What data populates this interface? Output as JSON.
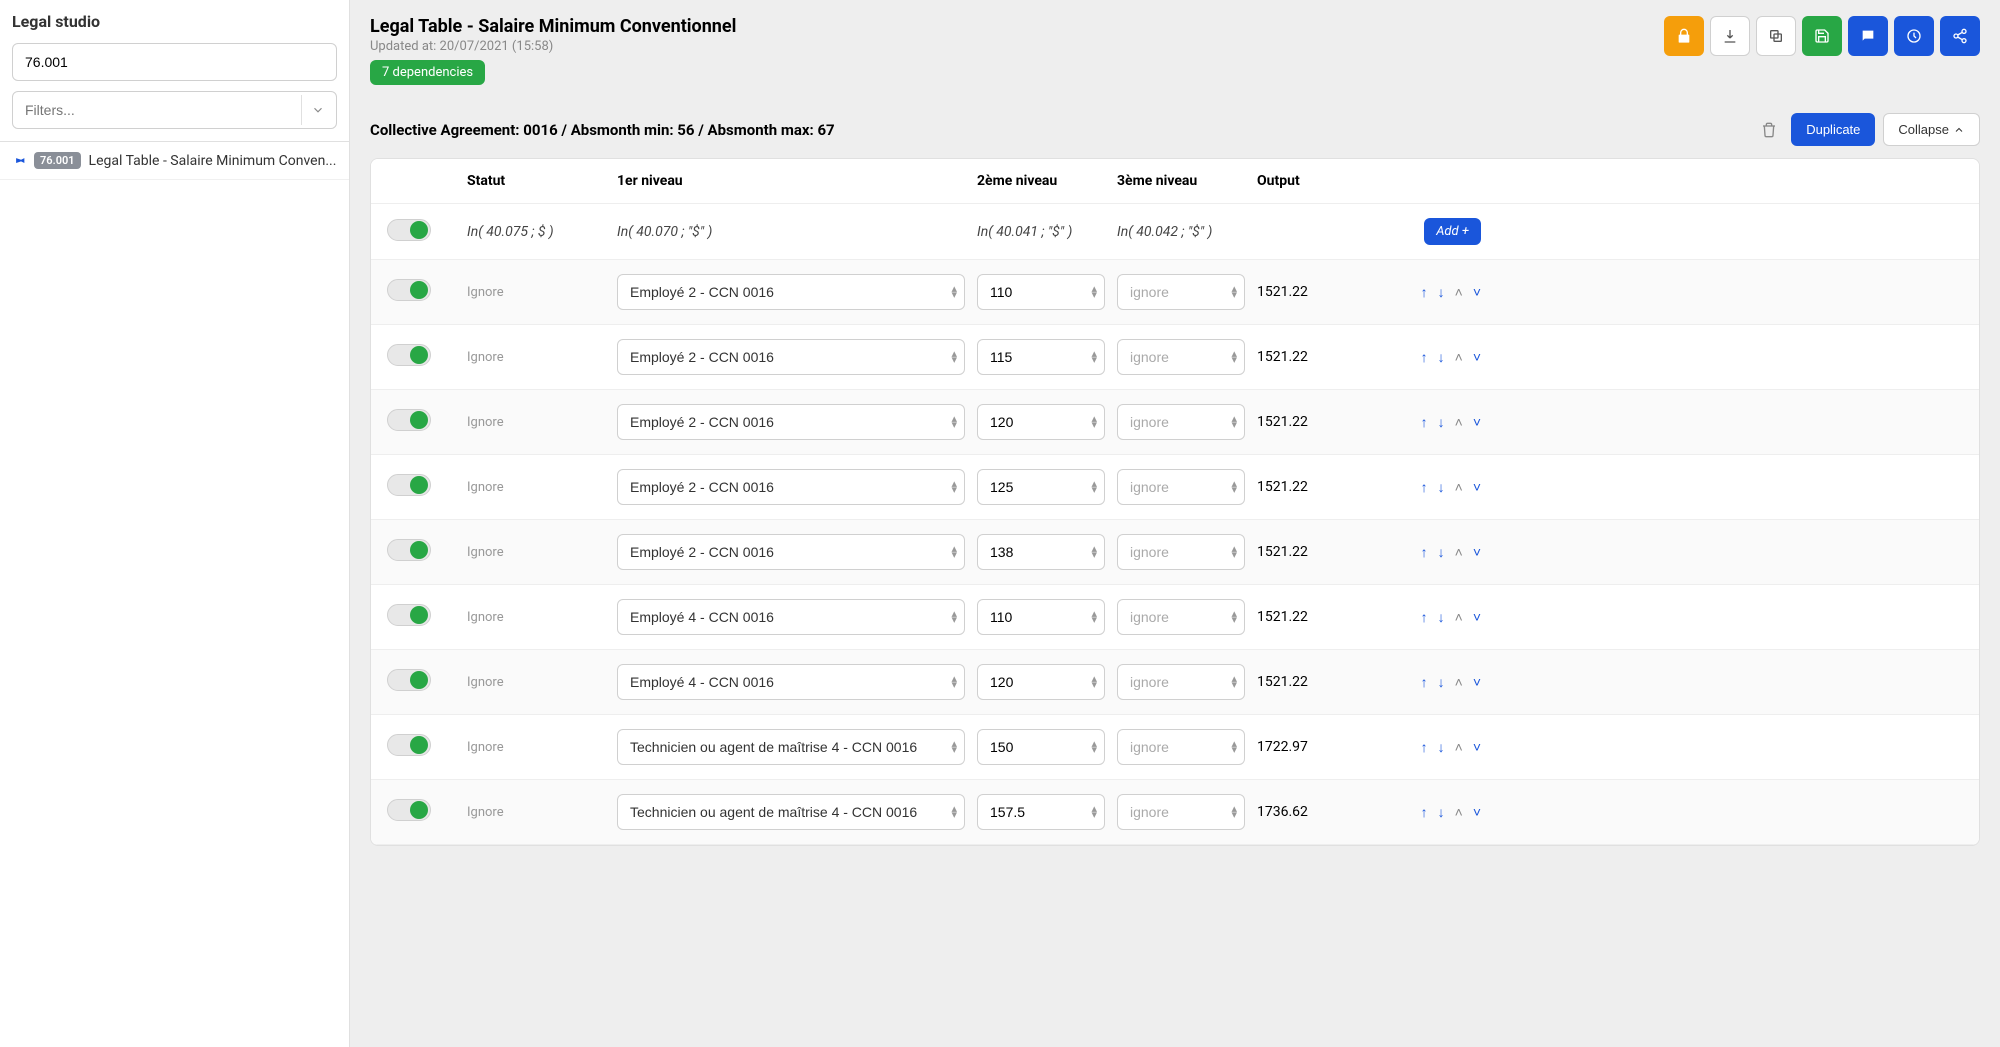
{
  "sidebar": {
    "title": "Legal studio",
    "search_value": "76.001",
    "filters_placeholder": "Filters...",
    "items": [
      {
        "badge": "76.001",
        "label": "Legal Table - Salaire Minimum Conven..."
      }
    ]
  },
  "header": {
    "title": "Legal Table - Salaire Minimum Conventionnel",
    "updated_at": "Updated at: 20/07/2021 (15:58)",
    "dependencies": "7 dependencies"
  },
  "section": {
    "title": "Collective Agreement: 0016 / Absmonth min: 56 / Absmonth max: 67",
    "duplicate": "Duplicate",
    "collapse": "Collapse"
  },
  "table": {
    "columns": {
      "statut": "Statut",
      "n1": "1er niveau",
      "n2": "2ème niveau",
      "n3": "3ème niveau",
      "output": "Output"
    },
    "formula": {
      "statut": "In( 40.075 ; $ )",
      "n1": "In( 40.070 ; \"$\" )",
      "n2": "In( 40.041 ; \"$\" )",
      "n3": "In( 40.042 ; \"$\" )",
      "add": "Add +"
    },
    "rows": [
      {
        "statut": "Ignore",
        "n1": "Employé 2 - CCN 0016",
        "n2": "110",
        "n3": "ignore",
        "output": "1521.22"
      },
      {
        "statut": "Ignore",
        "n1": "Employé 2 - CCN 0016",
        "n2": "115",
        "n3": "ignore",
        "output": "1521.22"
      },
      {
        "statut": "Ignore",
        "n1": "Employé 2 - CCN 0016",
        "n2": "120",
        "n3": "ignore",
        "output": "1521.22"
      },
      {
        "statut": "Ignore",
        "n1": "Employé 2 - CCN 0016",
        "n2": "125",
        "n3": "ignore",
        "output": "1521.22"
      },
      {
        "statut": "Ignore",
        "n1": "Employé 2 - CCN 0016",
        "n2": "138",
        "n3": "ignore",
        "output": "1521.22"
      },
      {
        "statut": "Ignore",
        "n1": "Employé 4 - CCN 0016",
        "n2": "110",
        "n3": "ignore",
        "output": "1521.22"
      },
      {
        "statut": "Ignore",
        "n1": "Employé 4 - CCN 0016",
        "n2": "120",
        "n3": "ignore",
        "output": "1521.22"
      },
      {
        "statut": "Ignore",
        "n1": "Technicien ou agent de maîtrise 4 - CCN 0016",
        "n2": "150",
        "n3": "ignore",
        "output": "1722.97"
      },
      {
        "statut": "Ignore",
        "n1": "Technicien ou agent de maîtrise 4 - CCN 0016",
        "n2": "157.5",
        "n3": "ignore",
        "output": "1736.62"
      }
    ]
  }
}
